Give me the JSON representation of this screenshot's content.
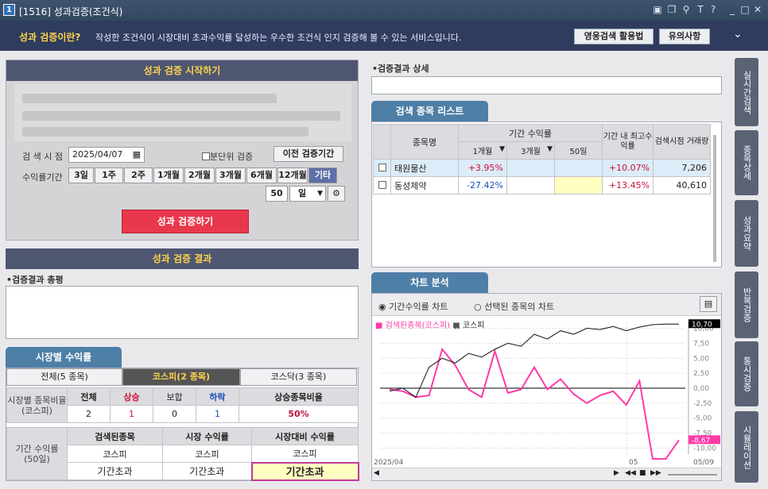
{
  "window": {
    "num": "1",
    "title": "[1516] 성과검증(조건식)"
  },
  "banner": {
    "question": "성과 검증이란?",
    "description": "작성한 조건식이 시장대비 초과수익률 달성하는 우수한 조건식 인지 검증해 볼 수 있는 서비스입니다.",
    "btn_guide": "영웅검색 활용법",
    "btn_notice": "유의사항"
  },
  "start": {
    "header": "성과 검증 시작하기",
    "date_label": "검 색 시 점",
    "date": "2025/04/07",
    "checkbox_label": "분단위 검증",
    "prev_btn": "이전 검증기간",
    "period_label": "수익률기간",
    "periods": [
      "3일",
      "1주",
      "2주",
      "1개월",
      "2개월",
      "3개월",
      "6개월",
      "12개월",
      "기타"
    ],
    "selected_period": "기타",
    "days_value": "50",
    "days_unit": "일",
    "run_button": "성과 검증하기"
  },
  "result": {
    "header": "성과 검증 결과",
    "summary_label": "•검증결과 총평"
  },
  "market": {
    "tab": "시장별 수익률",
    "subtabs": [
      "전체(5 종목)",
      "코스피(2 종목)",
      "코스닥(3 종목)"
    ],
    "row_label": "시장별 종목비율 (코스피)",
    "cols": [
      "전체",
      "상승",
      "보합",
      "하락",
      "상승종목비율"
    ],
    "vals": [
      "2",
      "1",
      "0",
      "1",
      "50%"
    ],
    "period_label": "기간 수익률 (50일)",
    "cols2": [
      "검색된종목",
      "시장 수익률",
      "시장대비 수익률"
    ],
    "market_name": "코스피",
    "expired": "기간초과"
  },
  "detail": {
    "label": "•검증결과 상세"
  },
  "list": {
    "tab": "검색 종목 리스트",
    "h_name": "종목명",
    "h_period": "기간 수익률",
    "h_1m": "1개월",
    "h_3m": "3개월",
    "h_50": "50일",
    "h_max": "기간 내 최고수익률",
    "h_vol": "검색시점 거래량",
    "rows": [
      {
        "name": "태원물산",
        "r1": "+3.95%",
        "max": "+10.07%",
        "vol": "7,206"
      },
      {
        "name": "동성제약",
        "r1": "-27.42%",
        "max": "+13.45%",
        "vol": "40,610"
      }
    ]
  },
  "chart": {
    "tab": "차트 분석",
    "radio1": "기간수익률 차트",
    "radio2": "선택된 종목의 차트",
    "legend1": "검색된종목(코스피)",
    "legend2": "코스피",
    "yticks": [
      "10,00",
      "7,50",
      "5,00",
      "2,50",
      "0,00",
      "-2,50",
      "-5,00",
      "-7,50",
      "-10,00"
    ],
    "last_black": "10,70",
    "last_pink": "-8,67",
    "x_start": "2025/04",
    "x_mid": "05",
    "x_end": "05/09"
  },
  "chart_data": {
    "type": "line",
    "ylim": [
      -11,
      11
    ],
    "series": [
      {
        "name": "검색된종목(코스피)",
        "color": "#ff3aa8",
        "values": [
          -0.2,
          -0.5,
          -1.5,
          -1.2,
          6.5,
          3.8,
          -0.2,
          -1.5,
          6.2,
          -0.8,
          -0.2,
          3.5,
          -0.2,
          1.5,
          -1.0,
          -2.5,
          -1.2,
          -0.5,
          -2.8,
          1.2,
          -11.8,
          -11.8,
          -8.67
        ]
      },
      {
        "name": "코스피",
        "color": "#111111",
        "values": [
          -0.5,
          0.0,
          -1.5,
          3.5,
          5.0,
          4.2,
          5.8,
          5.2,
          6.5,
          7.5,
          7.0,
          9.0,
          8.2,
          9.6,
          9.0,
          10.0,
          9.8,
          10.3,
          9.6,
          10.2,
          10.6,
          10.7,
          10.7
        ]
      }
    ]
  },
  "sidebar": [
    "실시간검색",
    "종목상세",
    "성과요약",
    "반복검증",
    "통시검증",
    "시뮬레이션"
  ]
}
